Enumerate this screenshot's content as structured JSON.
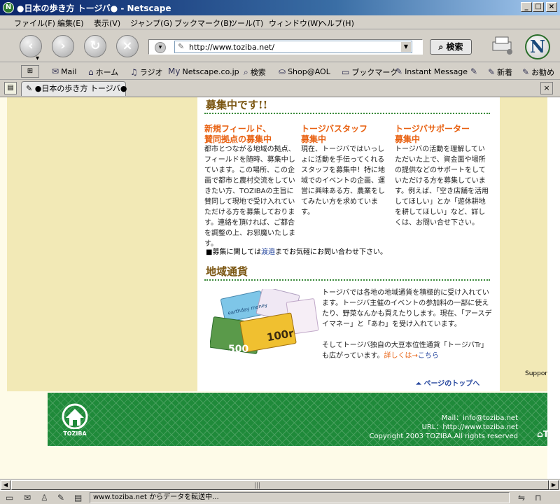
{
  "window": {
    "title": "●日本の歩き方 トージバ● - Netscape",
    "controls": {
      "minimize": "_",
      "maximize": "□",
      "close": "×"
    }
  },
  "menu": [
    "ファイル(F)",
    "編集(E)",
    "表示(V)",
    "ジャンプ(G)",
    "ブックマーク(B)",
    "ツール(T)",
    "ウィンドウ(W)",
    "ヘルプ(H)"
  ],
  "navigation": {
    "url": "http://www.toziba.net/",
    "search_label": "検索"
  },
  "personal_toolbar": {
    "items": [
      {
        "icon": "✉",
        "label": "Mail"
      },
      {
        "icon": "⌂",
        "label": "ホーム"
      },
      {
        "icon": "♫",
        "label": "ラジオ"
      },
      {
        "icon": "My",
        "label": "Netscape.co.jp"
      },
      {
        "icon": "⌕",
        "label": "検索"
      },
      {
        "icon": "⛀",
        "label": "Shop@AOL"
      },
      {
        "icon": "▭",
        "label": "ブックマーク"
      },
      {
        "icon": "✎",
        "label": "Instant Message"
      },
      {
        "icon": "✎",
        "label": ""
      },
      {
        "icon": "✎",
        "label": "新着"
      },
      {
        "icon": "✎",
        "label": "お勧め"
      }
    ]
  },
  "tab": {
    "label": "●日本の歩き方 トージバ●"
  },
  "page": {
    "recruit_heading": "募集中です!!",
    "columns": [
      {
        "title_lines": [
          "新規フィールド、",
          "賛同拠点の募集中"
        ],
        "body": "都市とつながる地域の拠点、フィールドを随時、募集中しています。この場所、この企画で都市と農村交流をしていきたい方、TOZIBAの主旨に賛同して現地で受け入れていただける方を募集しております。連絡を頂ければ、ご都合を調整の上、お邪魔いたします。"
      },
      {
        "title_lines": [
          "トージバスタッフ",
          "募集中"
        ],
        "body": "現在、トージバではいっしょに活動を手伝ってくれるスタッフを募集中！特に地域でのイベントの企画、運営に興味ある方、農業をしてみたい方を求めています。"
      },
      {
        "title_lines": [
          "トージバサポーター",
          "募集中"
        ],
        "body": "トージバの活動を理解していただいた上で、資金面や場所の提供などのサポートをしていただける方を募集しています。例えば、「空き店舗を活用してほしい」とか「遊休耕地を耕してほしい」など、詳しくは、お問い合せ下さい。"
      }
    ],
    "note": {
      "prefix": "■募集に関しては",
      "link": "渡邉",
      "suffix": "までお気軽にお問い合わせ下さい。"
    },
    "currency_heading": "地域通貨",
    "currency_body_1": "トージバでは各地の地域通貨を積極的に受け入れています。トージバ主催のイベントの参加料の一部に使えたり、野菜なんかも買えたりします。現在、「アースデイマネー」と「あわ」を受け入れています。",
    "currency_body_2": "そしてトージバ独自の大豆本位性通貨「トージバTr」も広がっています。",
    "details_link": "詳しくは→",
    "kochira_link": "こちら",
    "money_labels": {
      "earthday": "earthday money",
      "note_100": "100r",
      "note_500": "500"
    },
    "page_top": "ページのトップへ",
    "support": "Suppor"
  },
  "footer": {
    "logo_text": "TOZIBA",
    "mail": "Mail：info@toziba.net",
    "url": "URL：http://www.toziba.net",
    "copyright": "Copyright 2003 TOZIBA.All rights reserved",
    "corner": "T"
  },
  "status": {
    "text": "www.toziba.net からデータを転送中..."
  },
  "colors": {
    "title_gradient_start": "#0a246a",
    "accent_orange": "#e86010",
    "heading_brown": "#7a5510",
    "footer_green": "#1f8a3a",
    "side_panel": "#f2e9b6"
  }
}
